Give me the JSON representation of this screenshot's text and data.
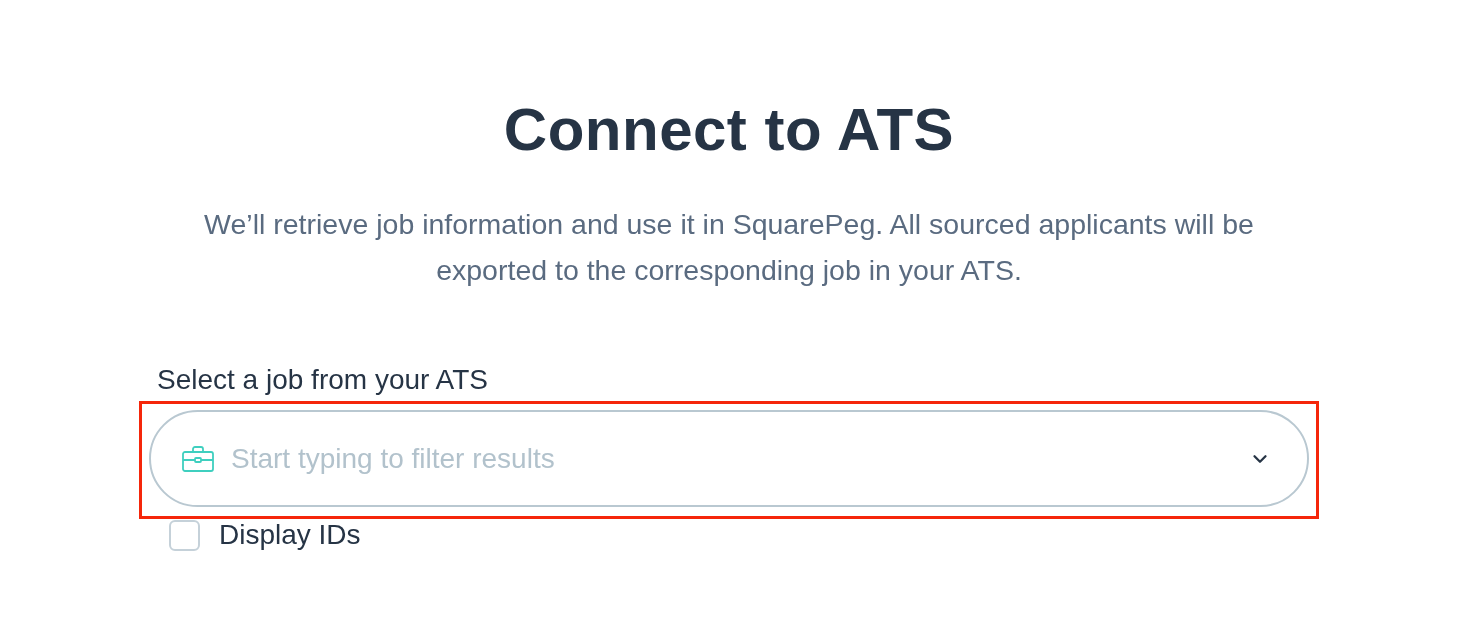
{
  "title": "Connect to ATS",
  "description": "We’ll retrieve job information and use it in SquarePeg. All sourced applicants will be exported to the corresponding job in your ATS.",
  "job_select": {
    "label": "Select a job from your ATS",
    "placeholder": "Start typing to filter results",
    "highlighted": true
  },
  "display_ids": {
    "label": "Display IDs",
    "checked": false
  }
}
